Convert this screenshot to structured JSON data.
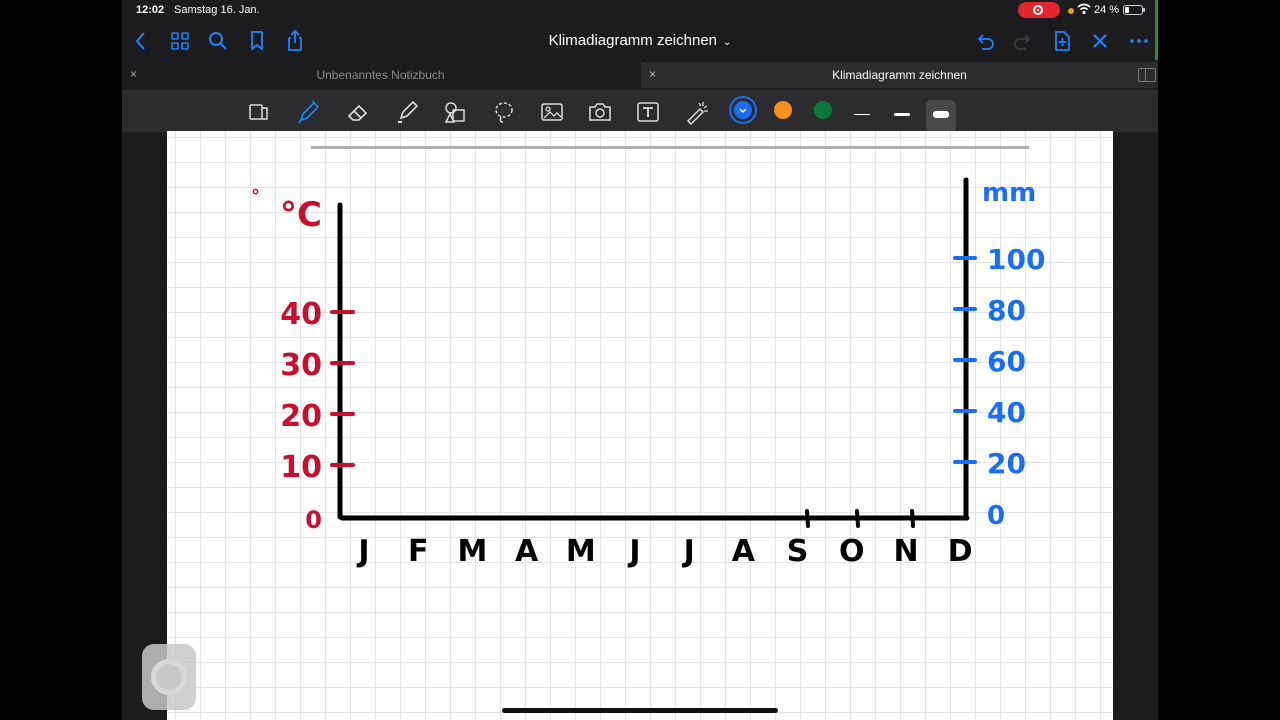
{
  "status": {
    "time": "12:02",
    "date": "Samstag 16. Jan.",
    "battery": "24 %",
    "battery_level": 0.24
  },
  "nav": {
    "title": "Klimadiagramm zeichnen",
    "chevron": "⌄"
  },
  "tabs": [
    {
      "label": "Unbenanntes Notizbuch",
      "close": "×",
      "active": false
    },
    {
      "label": "Klimadiagramm zeichnen",
      "close": "×",
      "active": true
    }
  ],
  "toolbar": {
    "colors": {
      "blue": "#1a6ef5",
      "orange": "#f5921e",
      "green": "#0a7a3b"
    }
  },
  "chart_data": {
    "type": "line",
    "title": "",
    "x": [
      "J",
      "F",
      "M",
      "A",
      "M",
      "J",
      "J",
      "A",
      "S",
      "O",
      "N",
      "D"
    ],
    "y_left": {
      "unit": "°C",
      "ticks": [
        "0",
        "10",
        "20",
        "30",
        "40"
      ]
    },
    "y_right": {
      "unit": "mm",
      "ticks": [
        "0",
        "20",
        "40",
        "60",
        "80",
        "100"
      ]
    },
    "series": [],
    "grid": true,
    "colors": {
      "left_axis": "#c8102e",
      "right_axis": "#1a6ef5",
      "axes": "#000000"
    }
  }
}
